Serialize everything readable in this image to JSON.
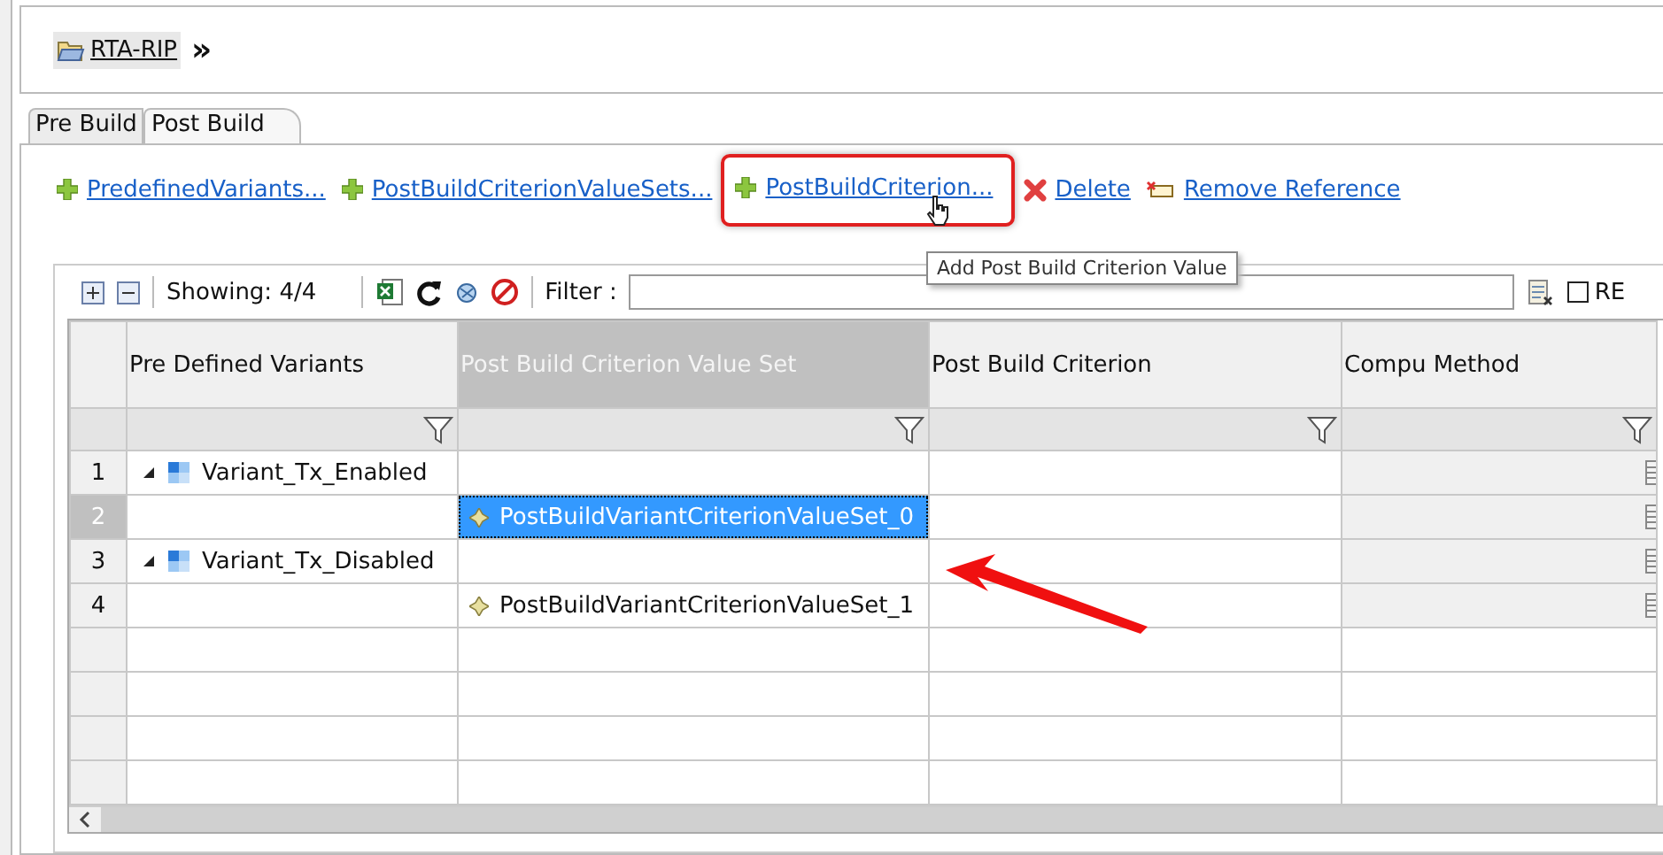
{
  "breadcrumb": {
    "label": "RTA-RIP",
    "separator": "»"
  },
  "tabs": [
    {
      "label": "Pre Build",
      "selected": false
    },
    {
      "label": "Post Build",
      "selected": true
    }
  ],
  "actions": [
    {
      "kind": "add",
      "label": "PredefinedVariants...",
      "highlighted": false
    },
    {
      "kind": "add",
      "label": "PostBuildCriterionValueSets...",
      "highlighted": false
    },
    {
      "kind": "add",
      "label": "PostBuildCriterion...",
      "highlighted": true
    },
    {
      "kind": "delete",
      "label": "Delete",
      "highlighted": false
    },
    {
      "kind": "remove-reference",
      "label": "Remove Reference",
      "highlighted": false
    }
  ],
  "tooltip": "Add Post Build Criterion Value",
  "toolbar": {
    "showing": "Showing: 4/4",
    "filter_label": "Filter :",
    "regex": {
      "label": "RE",
      "checked": false
    }
  },
  "table": {
    "columns": [
      {
        "name": "Pre Defined Variants",
        "selected": false
      },
      {
        "name": "Post Build Criterion Value Set",
        "selected": true
      },
      {
        "name": "Post Build Criterion",
        "selected": false
      },
      {
        "name": "Compu Method",
        "selected": false
      }
    ],
    "rows": [
      {
        "number": "1",
        "kind": "variant",
        "expanded": true,
        "label": "Variant_Tx_Enabled",
        "selected": false
      },
      {
        "number": "2",
        "kind": "value-set",
        "label": "PostBuildVariantCriterionValueSet_0",
        "selected": true
      },
      {
        "number": "3",
        "kind": "variant",
        "expanded": true,
        "label": "Variant_Tx_Disabled",
        "selected": false
      },
      {
        "number": "4",
        "kind": "value-set",
        "label": "PostBuildVariantCriterionValueSet_1",
        "selected": false
      }
    ]
  }
}
